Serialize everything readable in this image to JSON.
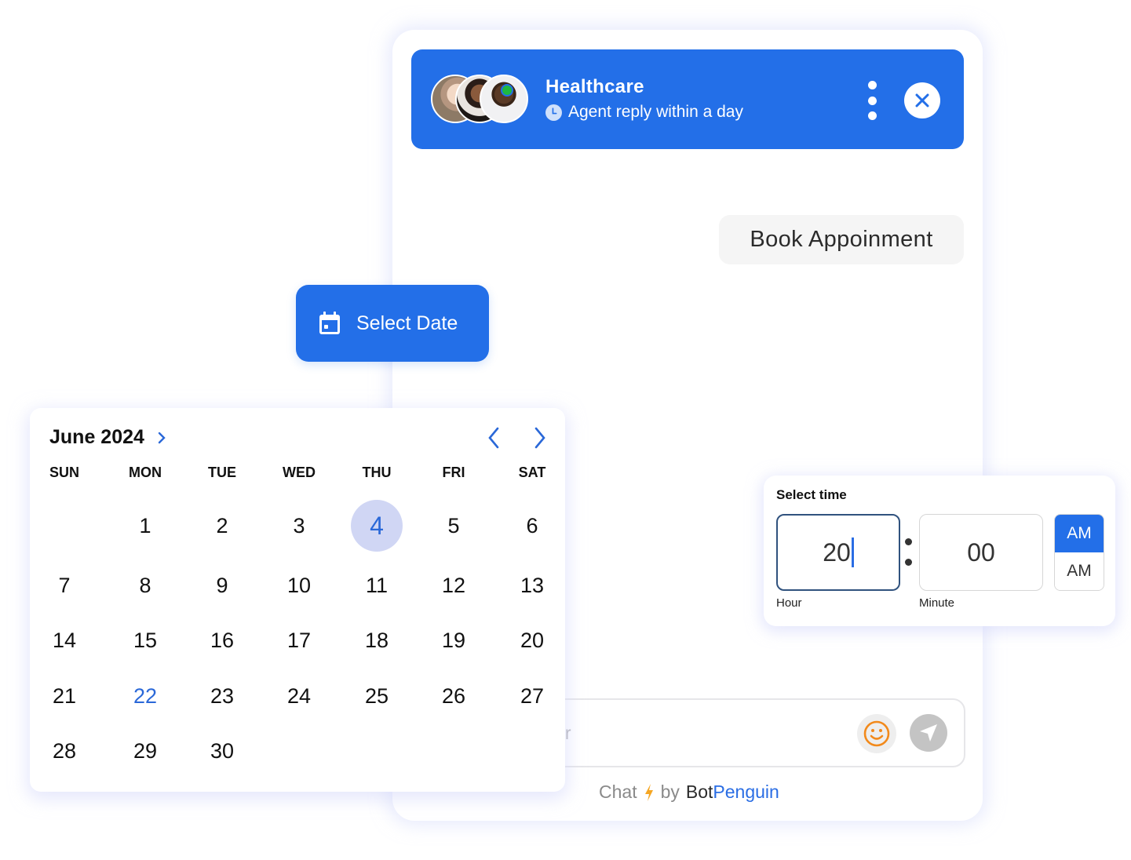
{
  "chat": {
    "header": {
      "title": "Healthcare",
      "subtitle": "Agent reply within a day",
      "status": "online",
      "colors": {
        "background": "#236fe8",
        "online": "#1fb841"
      }
    },
    "messages": [
      {
        "from": "user",
        "text": "Book Appoinment"
      }
    ],
    "input": {
      "placeholder": "Type your answer",
      "value": ""
    },
    "footer": {
      "prefix": "Chat",
      "by": "by",
      "brand_part1": "Bot",
      "brand_part2": "Penguin"
    }
  },
  "select_date_button": {
    "label": "Select Date"
  },
  "calendar": {
    "title": "June 2024",
    "weekdays": [
      "SUN",
      "MON",
      "TUE",
      "WED",
      "THU",
      "FRI",
      "SAT"
    ],
    "first_weekday_index": 6,
    "weeks": [
      [
        "",
        "1",
        "2",
        "3",
        "4",
        "5",
        "6"
      ],
      [
        "7",
        "8",
        "9",
        "10",
        "11",
        "12",
        "13"
      ],
      [
        "14",
        "15",
        "16",
        "17",
        "18",
        "19",
        "20"
      ],
      [
        "21",
        "22",
        "23",
        "24",
        "25",
        "26",
        "27"
      ],
      [
        "28",
        "29",
        "30",
        "",
        "",
        "",
        ""
      ]
    ],
    "selected_day": "4",
    "highlighted_day": "22",
    "colors": {
      "selected_bg": "#d0d6f4",
      "accent": "#2a68d8"
    }
  },
  "time_picker": {
    "title": "Select time",
    "hour": "20",
    "minute": "00",
    "hour_label": "Hour",
    "minute_label": "Minute",
    "period_options": [
      "AM",
      "AM"
    ],
    "selected_period_index": 0
  }
}
